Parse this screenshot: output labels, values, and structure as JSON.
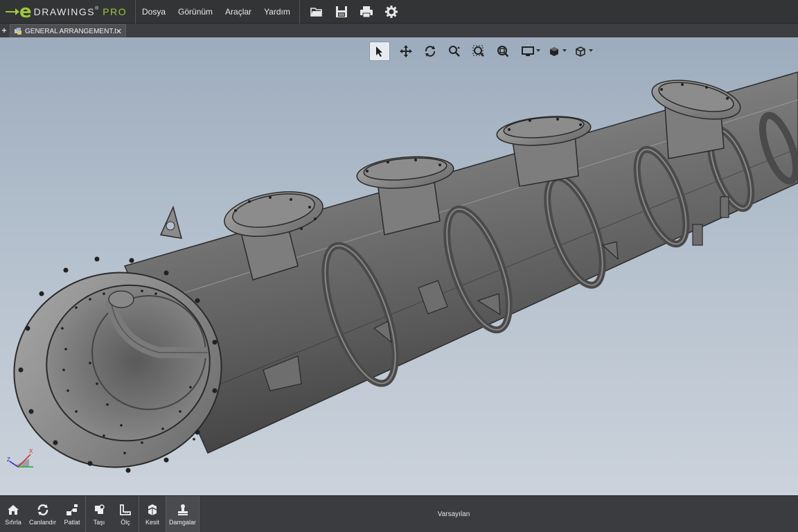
{
  "app": {
    "logo_e": "e",
    "logo_text": "DRAWINGS",
    "logo_reg": "®",
    "logo_pro": "PRO"
  },
  "menu": {
    "items": [
      {
        "label": "Dosya"
      },
      {
        "label": "Görünüm"
      },
      {
        "label": "Araçlar"
      },
      {
        "label": "Yardım"
      }
    ]
  },
  "toolbar": {
    "icons": [
      "open-folder-icon",
      "save-icon",
      "print-icon",
      "settings-gear-icon"
    ]
  },
  "tabs": {
    "add_symbol": "+",
    "items": [
      {
        "label": "GENERAL ARRANGEMENT.EASM",
        "close_symbol": "✕"
      }
    ]
  },
  "view_tools": {
    "icons": [
      "select-arrow-icon",
      "pan-icon",
      "rotate-icon",
      "zoom-icon",
      "zoom-area-icon",
      "zoom-fit-icon",
      "display-style-icon",
      "shaded-view-icon",
      "view-orientation-icon"
    ]
  },
  "triad": {
    "z": "Z",
    "x": "X"
  },
  "bottom_toolbar": {
    "groups": [
      [
        {
          "label": "Sıfırla",
          "icon": "home-icon"
        },
        {
          "label": "Canlandır",
          "icon": "animate-icon"
        },
        {
          "label": "Patlat",
          "icon": "explode-icon"
        }
      ],
      [
        {
          "label": "Taşı",
          "icon": "move-icon"
        },
        {
          "label": "Ölç",
          "icon": "measure-icon"
        }
      ],
      [
        {
          "label": "Kesit",
          "icon": "section-icon"
        }
      ],
      [
        {
          "label": "Damgalar",
          "icon": "stamp-icon"
        }
      ]
    ]
  },
  "status": {
    "label": "Varsayılan"
  },
  "colors": {
    "accent": "#9ec83c",
    "chrome": "#333436",
    "viewport_top": "#9dacbd",
    "viewport_bottom": "#cbd2db"
  }
}
